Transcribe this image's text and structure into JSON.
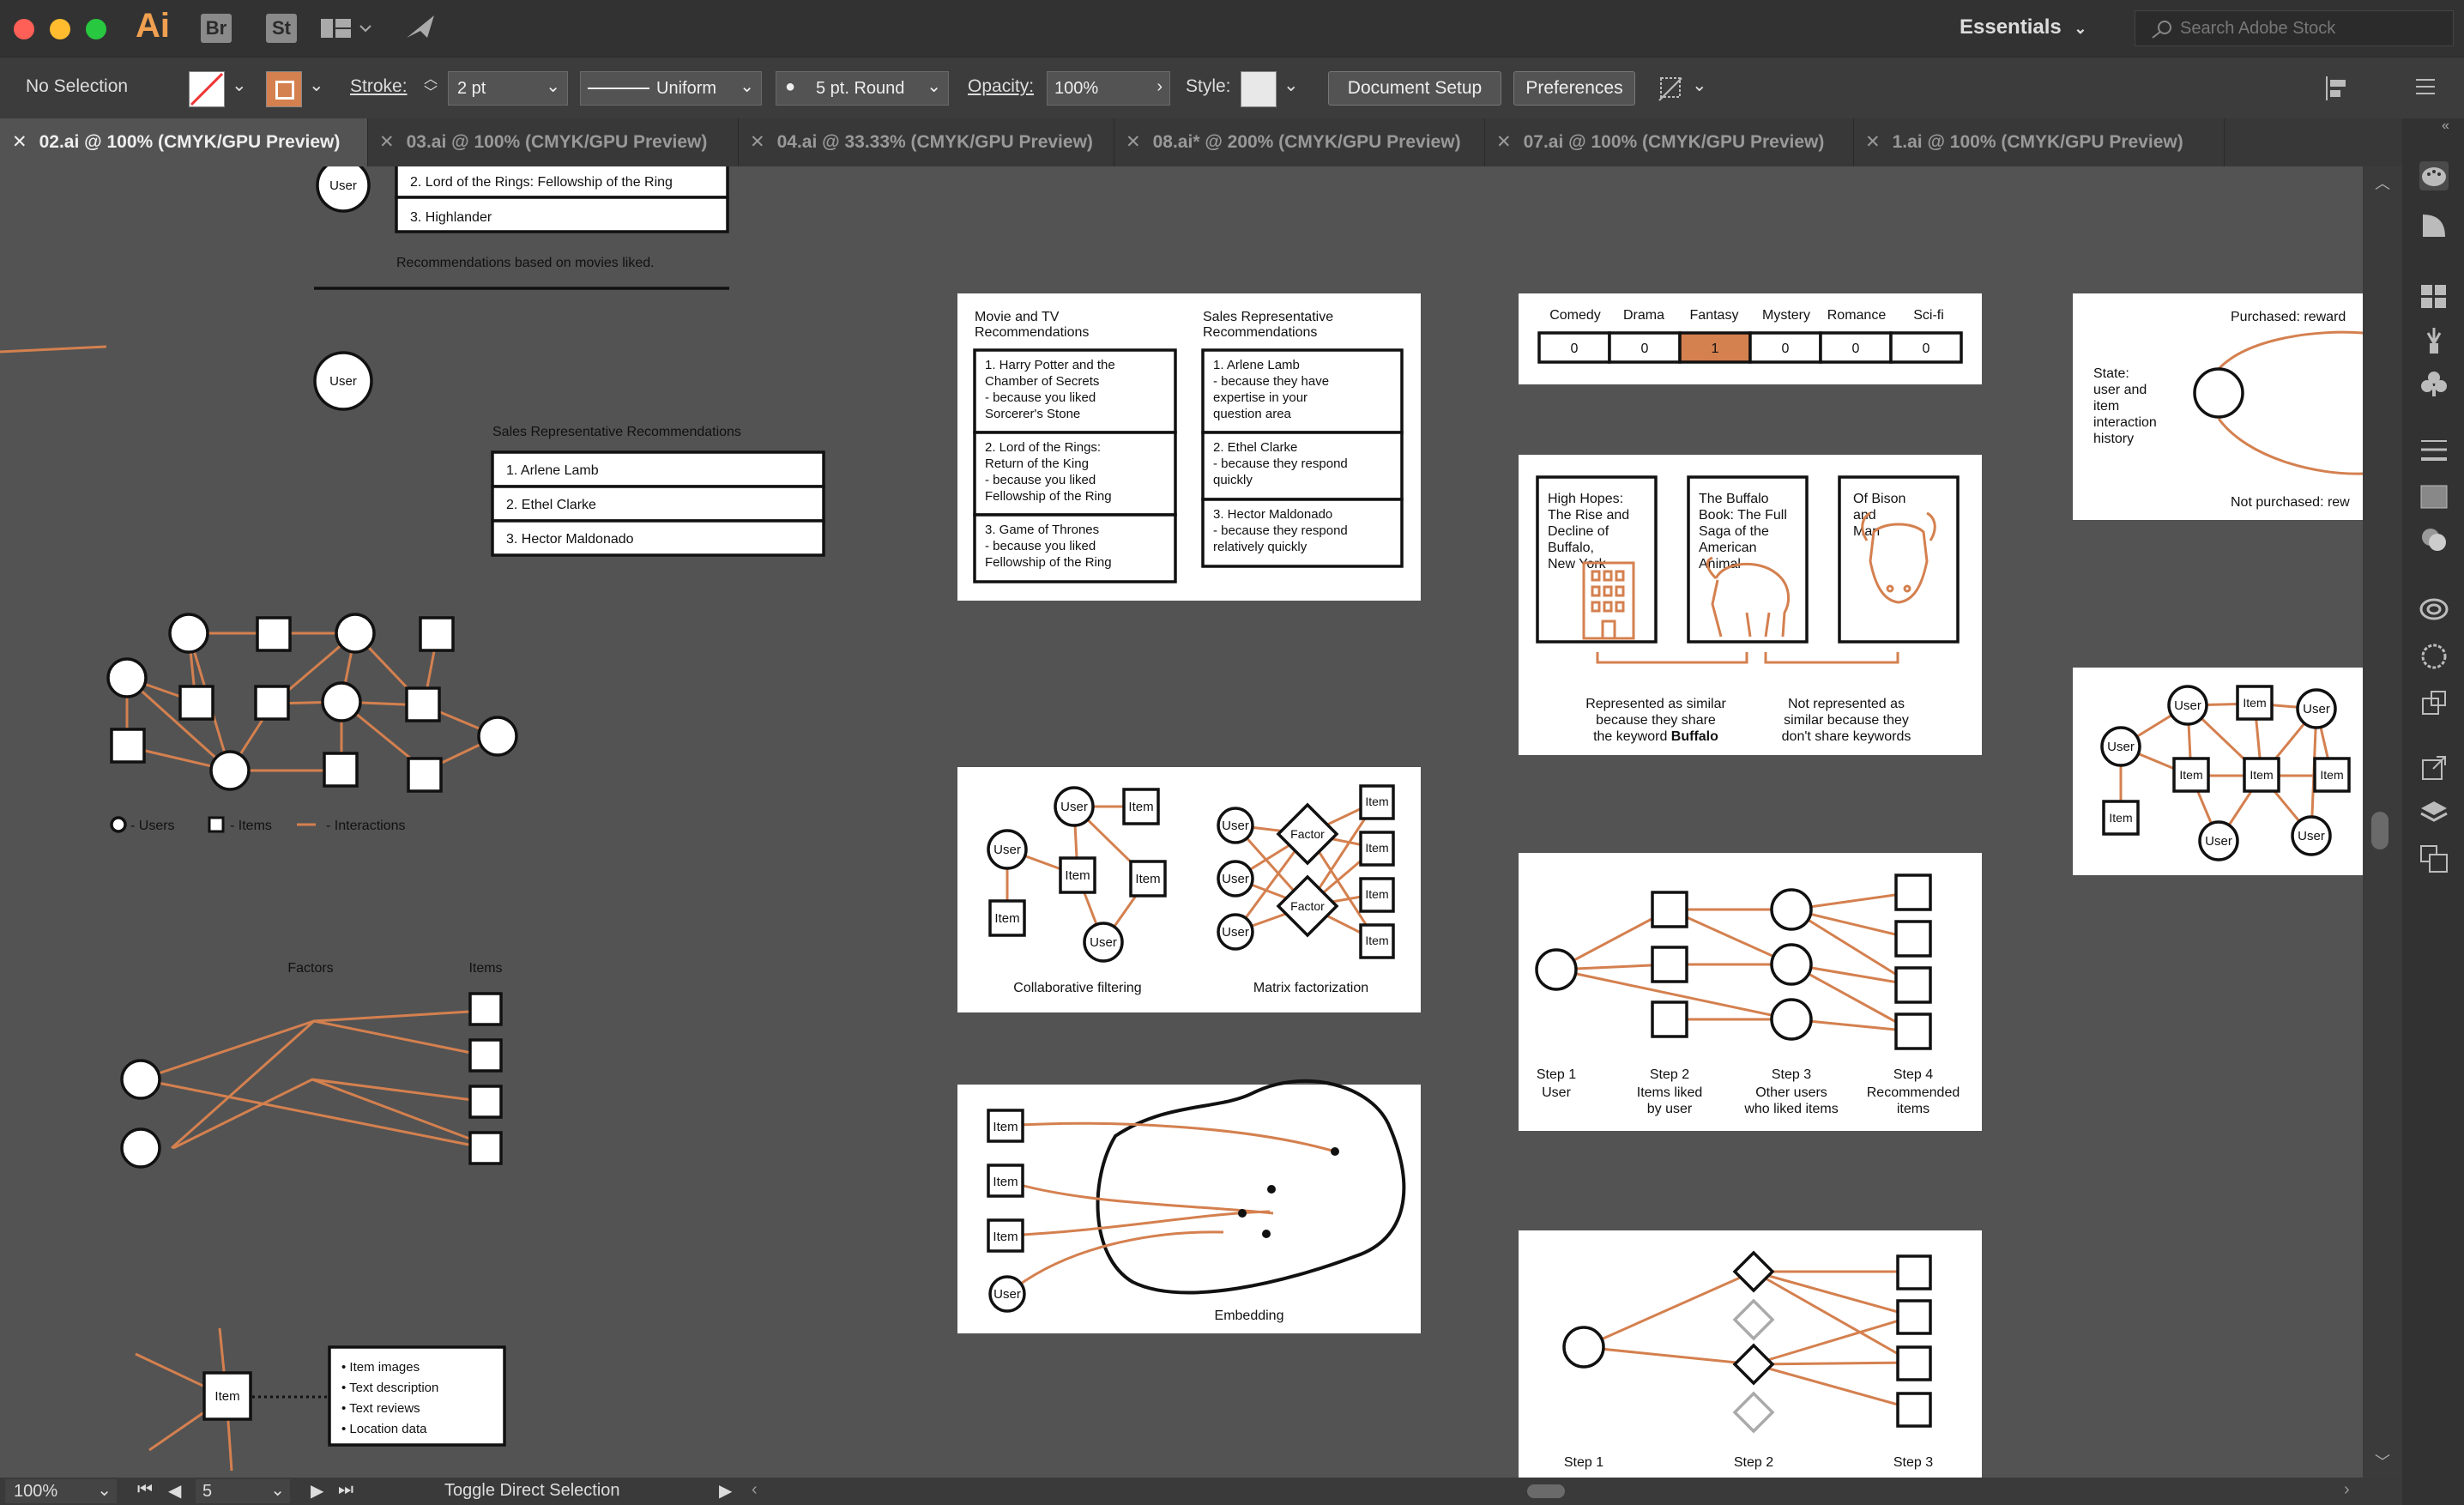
{
  "app": {
    "name": "Ai",
    "workspace": "Essentials",
    "search_placeholder": "Search Adobe Stock",
    "bridge_label": "Br",
    "stock_label": "St"
  },
  "control_bar": {
    "selection": "No Selection",
    "stroke_label": "Stroke:",
    "stroke_value": "2 pt",
    "profile": "Uniform",
    "brush": "5 pt. Round",
    "opacity_label": "Opacity:",
    "opacity_value": "100%",
    "style_label": "Style:",
    "document_setup": "Document Setup",
    "preferences": "Preferences"
  },
  "tabs": [
    {
      "label": "02.ai @ 100% (CMYK/GPU Preview)",
      "active": true
    },
    {
      "label": "03.ai @ 100% (CMYK/GPU Preview)",
      "active": false
    },
    {
      "label": "04.ai @ 33.33% (CMYK/GPU Preview)",
      "active": false
    },
    {
      "label": "08.ai* @ 200% (CMYK/GPU Preview)",
      "active": false
    },
    {
      "label": "07.ai @ 100% (CMYK/GPU Preview)",
      "active": false
    },
    {
      "label": "1.ai @ 100% (CMYK/GPU Preview)",
      "active": false
    }
  ],
  "status": {
    "zoom": "100%",
    "artboard": "5",
    "tool": "Toggle Direct Selection"
  },
  "colors": {
    "accent": "#d4804f",
    "canvas": "#535353",
    "chrome": "#323232"
  },
  "canvas": {
    "left_list": {
      "user": "User",
      "item2": "2. Lord of the Rings: Fellowship of the Ring",
      "item3": "3. Highlander",
      "caption": "Recommendations based on movies liked."
    },
    "sales_list": {
      "user": "User",
      "title": "Sales Representative Recommendations",
      "items": [
        "1. Arlene Lamb",
        "2. Ethel Clarke",
        "3. Hector Maldonado"
      ]
    },
    "graph_legend": {
      "users": "- Users",
      "items": "- Items",
      "interactions": "- Interactions"
    },
    "factors_diagram": {
      "factors": "Factors",
      "items": "Items"
    },
    "item_info": {
      "item": "Item",
      "bullets": [
        "• Item images",
        "• Text description",
        "• Text reviews",
        "• Location data"
      ]
    },
    "recs_board": {
      "col1_title": [
        "Movie and TV",
        "Recommendations"
      ],
      "col2_title": [
        "Sales Representative",
        "Recommendations"
      ],
      "col1": [
        {
          "title": [
            "1. Harry Potter and the",
            "Chamber of Secrets"
          ],
          "reason": [
            "- because you liked",
            "Sorcerer's Stone"
          ]
        },
        {
          "title": [
            "2. Lord of the Rings:",
            "Return of the King"
          ],
          "reason": [
            "- because you liked",
            "Fellowship of the Ring"
          ]
        },
        {
          "title": [
            "3. Game of Thrones"
          ],
          "reason": [
            "- because you liked",
            "Fellowship of the Ring"
          ]
        }
      ],
      "col2": [
        {
          "title": [
            "1. Arlene Lamb"
          ],
          "reason": [
            "- because they have",
            "expertise in your",
            "question area"
          ]
        },
        {
          "title": [
            "2. Ethel Clarke"
          ],
          "reason": [
            "- because they respond",
            "quickly"
          ]
        },
        {
          "title": [
            "3. Hector Maldonado"
          ],
          "reason": [
            "- because they respond",
            "relatively quickly"
          ]
        }
      ]
    },
    "cf_board": {
      "user": "User",
      "item": "Item",
      "factor": "Factor",
      "cf_caption": "Collaborative filtering",
      "mf_caption": "Matrix factorization"
    },
    "embedding_board": {
      "item": "Item",
      "user": "User",
      "caption": "Embedding"
    },
    "genre_board": {
      "genres": [
        "Comedy",
        "Drama",
        "Fantasy",
        "Mystery",
        "Romance",
        "Sci-fi"
      ],
      "values": [
        "0",
        "0",
        "1",
        "0",
        "0",
        "0"
      ]
    },
    "books_board": {
      "books": [
        [
          "High Hopes:",
          "The Rise and",
          "Decline of",
          "Buffalo,",
          "New York"
        ],
        [
          "The Buffalo",
          "Book: The Full",
          "Saga of the",
          "American",
          "Animal"
        ],
        [
          "Of Bison",
          "and",
          "Man"
        ]
      ],
      "similar": [
        "Represented as similar",
        "because they share",
        "the keyword "
      ],
      "similar_keyword": "Buffalo",
      "not_similar": [
        "Not represented as",
        "similar because they",
        "don't share keywords"
      ]
    },
    "steps_board": {
      "steps": [
        {
          "step": "Step 1",
          "label": [
            "User"
          ]
        },
        {
          "step": "Step 2",
          "label": [
            "Items liked",
            "by user"
          ]
        },
        {
          "step": "Step 3",
          "label": [
            "Other users",
            "who liked items"
          ]
        },
        {
          "step": "Step 4",
          "label": [
            "Recommended",
            "items"
          ]
        }
      ]
    },
    "steps3_board": {
      "steps": [
        "Step 1",
        "Step 2",
        "Step 3"
      ]
    },
    "state_board": {
      "purchased": "Purchased: reward",
      "not_purchased": "Not purchased: rew",
      "state": [
        "State:",
        "user and",
        "item",
        "interaction",
        "history"
      ]
    },
    "bipartite_board": {
      "user": "User",
      "item": "Item"
    }
  }
}
